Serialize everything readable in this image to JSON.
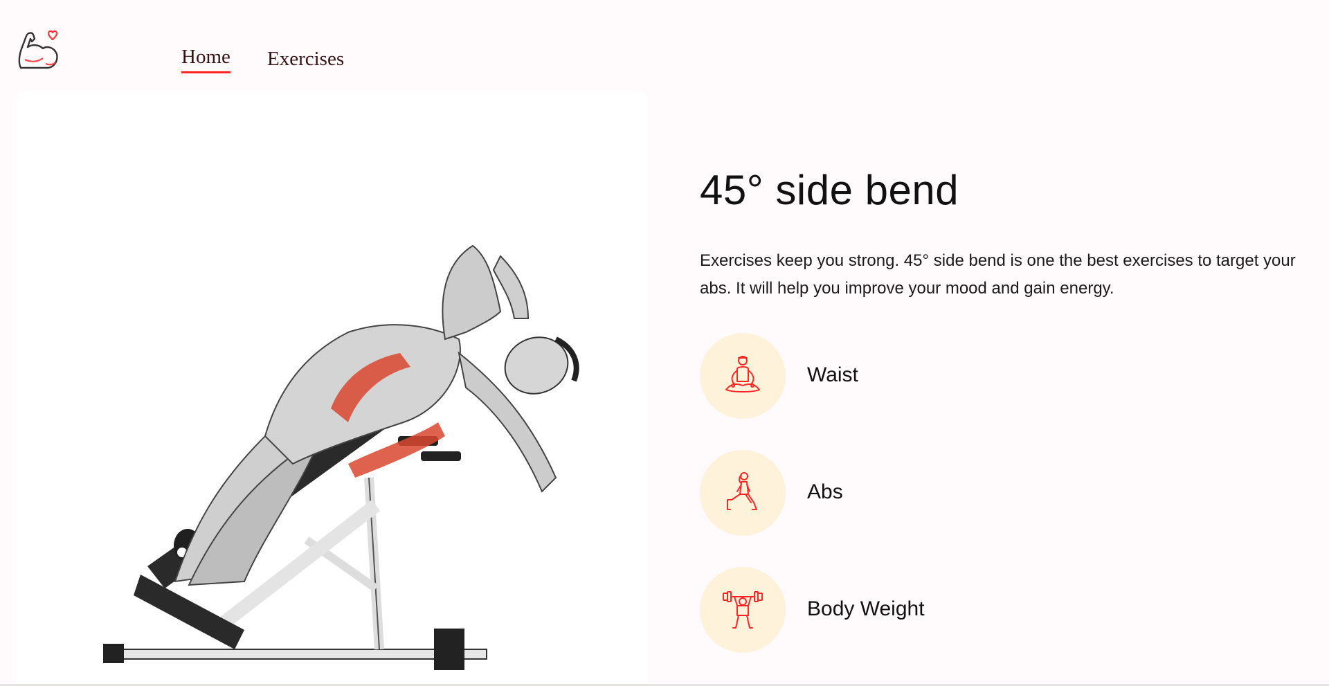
{
  "nav": {
    "logo_name": "flexed-arm-heart-logo",
    "links": [
      {
        "label": "Home",
        "active": true
      },
      {
        "label": "Exercises",
        "active": false
      }
    ],
    "accent_color": "#ff2625"
  },
  "exercise": {
    "image_alt": "45° side bend demonstration",
    "title": "45° side bend",
    "description": "Exercises keep you strong. 45° side bend is one the best exercises to target your abs. It will help you improve your mood and gain energy.",
    "tags": [
      {
        "icon": "meditation-icon",
        "label": "Waist"
      },
      {
        "icon": "lunge-icon",
        "label": "Abs"
      },
      {
        "icon": "weightlifter-icon",
        "label": "Body Weight"
      }
    ],
    "tag_circle_color": "#fff2db",
    "icon_color": "#ff2625"
  }
}
